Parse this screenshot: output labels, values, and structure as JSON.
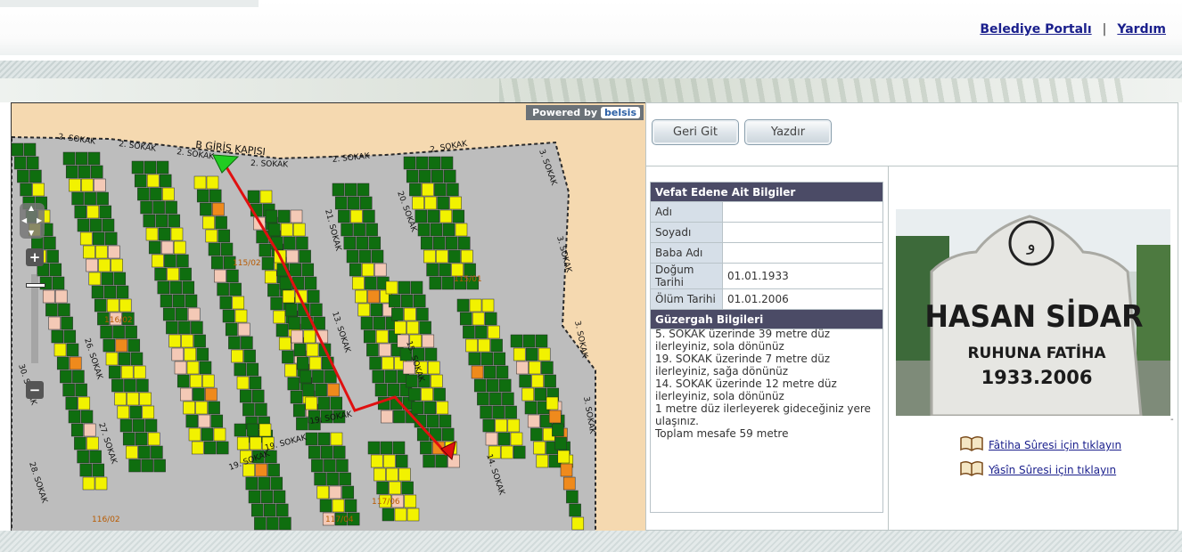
{
  "header": {
    "links": [
      {
        "label": "Belediye Portalı"
      },
      {
        "label": "Yardım"
      }
    ],
    "separator": "|"
  },
  "map": {
    "powered_by": "Powered by",
    "powered_logo": "belsis",
    "street_labels": [
      "2. SOKAK",
      "2. SOKAK",
      "2. SOKAK",
      "2. SOKAK",
      "2. SOKAK",
      "2. SOKAK",
      "3. SOKAK",
      "3. SOKAK",
      "3. SOKAK",
      "3. SOKAK",
      "20. SOKAK",
      "21. SOKAK",
      "13. SOKAK",
      "15. SOKAK",
      "19. SOKAK",
      "19. SOKAK",
      "19. SOKAK",
      "26. SOKAK",
      "27. SOKAK",
      "28. SOKAK",
      "30. SOKAK",
      "14. SOKAK"
    ],
    "gate_label": "B GİRİŞ KAPISI",
    "block_labels": [
      "115/02",
      "115/01",
      "116/02",
      "117/06",
      "117/04",
      "116/02"
    ],
    "zoom_in": "+",
    "zoom_out": "−"
  },
  "toolbar": {
    "back_label": "Geri Git",
    "print_label": "Yazdır"
  },
  "deceased": {
    "section_title": "Vefat Edene Ait Bilgiler",
    "rows": [
      {
        "key": "Adı",
        "value": ""
      },
      {
        "key": "Soyadı",
        "value": ""
      },
      {
        "key": "Baba Adı",
        "value": ""
      },
      {
        "key": "Doğum Tarihi",
        "value": "01.01.1933"
      },
      {
        "key": "Ölüm Tarihi",
        "value": "01.01.2006"
      }
    ]
  },
  "route": {
    "section_title": "Güzergah Bilgileri",
    "lines": [
      "5. SOKAK üzerinde 39 metre düz ilerleyiniz, sola dönünüz",
      "19. SOKAK üzerinde 7 metre düz ilerleyiniz, sağa dönünüz",
      "14. SOKAK üzerinde 12 metre düz ilerleyiniz, sola dönünüz",
      "1 metre düz ilerleyerek gideceğiniz yere ulaşınız.",
      "Toplam mesafe 59 metre"
    ]
  },
  "tombstone": {
    "name": "HASAN SİDAR",
    "epitaph": "RUHUNA FATİHA",
    "years": "1933.2006"
  },
  "prayers": [
    {
      "label": "Fâtiha Sûresi için tıklayın",
      "icon": "book-icon"
    },
    {
      "label": "Yâsîn Sûresi için tıklayın",
      "icon": "book-icon"
    }
  ],
  "colors": {
    "link": "#1a1f8c",
    "section_header": "#4b4b66",
    "key_cell": "#d6dfe8",
    "route_line": "#e01010",
    "grave_green": "#0f6e0f",
    "grave_yellow": "#f2f200",
    "road_gray": "#bdbdbd",
    "sand": "#f5d9b0"
  }
}
